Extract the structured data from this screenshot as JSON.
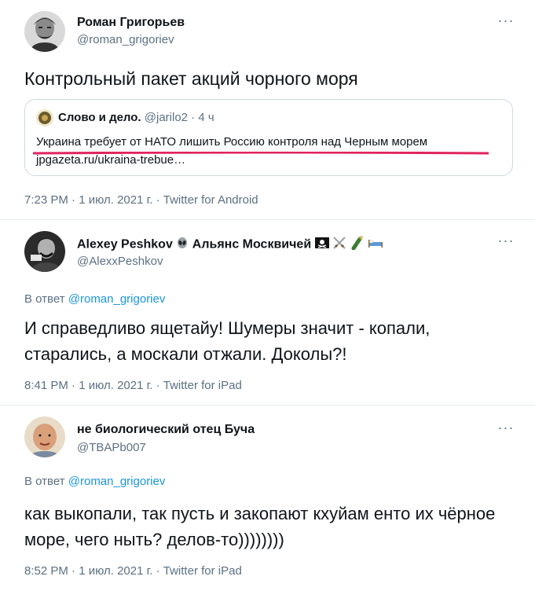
{
  "more_glyph": "···",
  "tweets": [
    {
      "name": "Роман Григорьев",
      "handle": "@roman_grigoriev",
      "text": "Контрольный пакет акций чорного моря",
      "meta": "7:23 PM · 1 июл. 2021 г. · Twitter for Android",
      "quote": {
        "name": "Слово и дело.",
        "handle_time": "@jarilo2 · 4 ч",
        "text": "Украина требует от НАТО лишить Россию контроля над Черным морем",
        "link": "jpgazeta.ru/ukraina-trebue…"
      }
    },
    {
      "name": "Alexey Peshkov",
      "name_suffix": "Альянс Москвичей",
      "handle": "@AlexxPeshkov",
      "reply_prefix": "В ответ",
      "reply_mention": "@roman_grigoriev",
      "text": "И справедливо ящетайу! Шумеры значит - копали, старались, а москали отжали. Доколы?!",
      "meta": "8:41 PM · 1 июл. 2021 г. · Twitter for iPad"
    },
    {
      "name": "не биологический отец Буча",
      "handle": "@TBAPb007",
      "reply_prefix": "В ответ",
      "reply_mention": "@roman_grigoriev",
      "text": "как выкопали, так пусть и закопают кхуйам енто их чёрное море, чего ныть? делов-то))))))))",
      "meta": "8:52 PM · 1 июл. 2021 г. · Twitter for iPad"
    }
  ],
  "icons": [
    "more-icon",
    "alien-icon",
    "pirate-flag-icon",
    "crossed-swords-icon",
    "champagne-icon",
    "bed-icon"
  ],
  "colors": {
    "link": "#1b95e0",
    "secondary": "#5b7083",
    "underline": "#e0245e",
    "divider": "#e6ecf0"
  }
}
